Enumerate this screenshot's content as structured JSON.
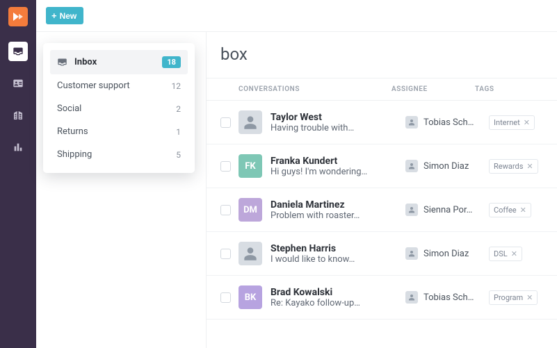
{
  "topbar": {
    "new_label": "New"
  },
  "rail": {
    "items": [
      "inbox",
      "contacts",
      "organizations",
      "reports"
    ]
  },
  "folders": {
    "items": [
      {
        "label": "Inbox",
        "count": "18",
        "active": true,
        "icon": true
      },
      {
        "label": "Customer support",
        "count": "12"
      },
      {
        "label": "Social",
        "count": "2"
      },
      {
        "label": "Returns",
        "count": "1"
      },
      {
        "label": "Shipping",
        "count": "5"
      }
    ]
  },
  "page": {
    "title_fragment": "box",
    "columns": {
      "conversations": "CONVERSATIONS",
      "assignee": "ASSIGNEE",
      "tags": "TAGS"
    }
  },
  "rows": [
    {
      "avatar": {
        "kind": "img"
      },
      "name": "Taylor West",
      "preview": "Having trouble with…",
      "assignee": "Tobias Sch…",
      "tag": "Internet"
    },
    {
      "avatar": {
        "kind": "initials",
        "text": "FK",
        "color": "teal"
      },
      "name": "Franka Kundert",
      "preview": "Hi guys! I'm wondering…",
      "assignee": "Simon Diaz",
      "tag": "Rewards"
    },
    {
      "avatar": {
        "kind": "initials",
        "text": "DM",
        "color": "lilac"
      },
      "name": "Daniela Martinez",
      "preview": "Problem with roaster…",
      "assignee": "Sienna Por…",
      "tag": "Coffee"
    },
    {
      "avatar": {
        "kind": "img"
      },
      "name": "Stephen Harris",
      "preview": "I would like to know…",
      "assignee": "Simon Diaz",
      "tag": "DSL"
    },
    {
      "avatar": {
        "kind": "initials",
        "text": "BK",
        "color": "lav"
      },
      "name": "Brad Kowalski",
      "preview": "Re: Kayako follow-up…",
      "assignee": "Tobias Sch…",
      "tag": "Program"
    }
  ]
}
